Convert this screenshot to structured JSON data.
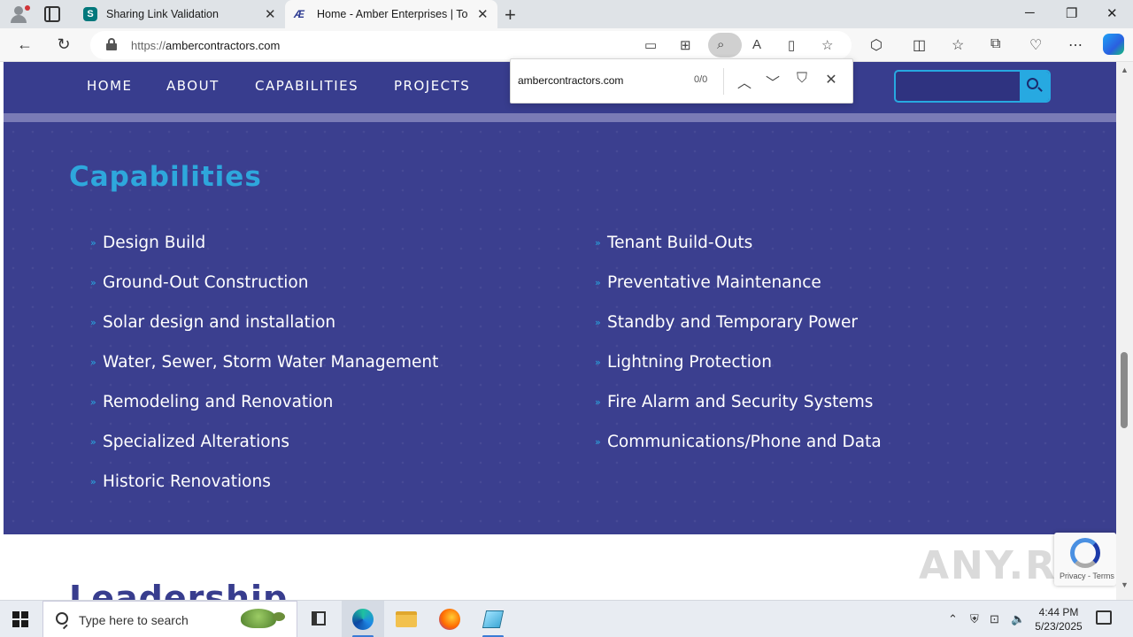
{
  "browser": {
    "tabs": [
      {
        "title": "Sharing Link Validation",
        "favicon": "sharepoint-s-icon",
        "favicon_text": "S"
      },
      {
        "title": "Home - Amber Enterprises | Top-",
        "favicon": "amber-logo-icon",
        "favicon_text": "Æ"
      }
    ],
    "url_scheme": "https://",
    "url_host": "ambercontractors.com",
    "new_tab_glyph": "+",
    "close_glyph": "✕"
  },
  "findbar": {
    "query": "ambercontractors.com",
    "count": "0/0"
  },
  "site": {
    "menu": [
      "HOME",
      "ABOUT",
      "CAPABILITIES",
      "PROJECTS"
    ],
    "search_placeholder": "",
    "accent_color": "#27a9e1",
    "background_color": "#3b3f8f"
  },
  "capabilities": {
    "title": "Capabilities",
    "bullet_glyph": "»",
    "left": [
      "Design Build",
      "Ground-Out Construction",
      "Solar design and installation",
      "Water, Sewer, Storm Water Management",
      "Remodeling and Renovation",
      "Specialized Alterations",
      "Historic Renovations"
    ],
    "right": [
      "Tenant Build-Outs",
      "Preventative Maintenance",
      "Standby and Temporary Power",
      "Lightning Protection",
      "Fire Alarm and Security Systems",
      "Communications/Phone and Data"
    ]
  },
  "leadership": {
    "title": "Leadership"
  },
  "recaptcha": {
    "text": "Privacy - Terms"
  },
  "watermark": "ANY.RUN",
  "taskbar": {
    "search_placeholder": "Type here to search",
    "time": "4:44 PM",
    "date": "5/23/2025"
  }
}
